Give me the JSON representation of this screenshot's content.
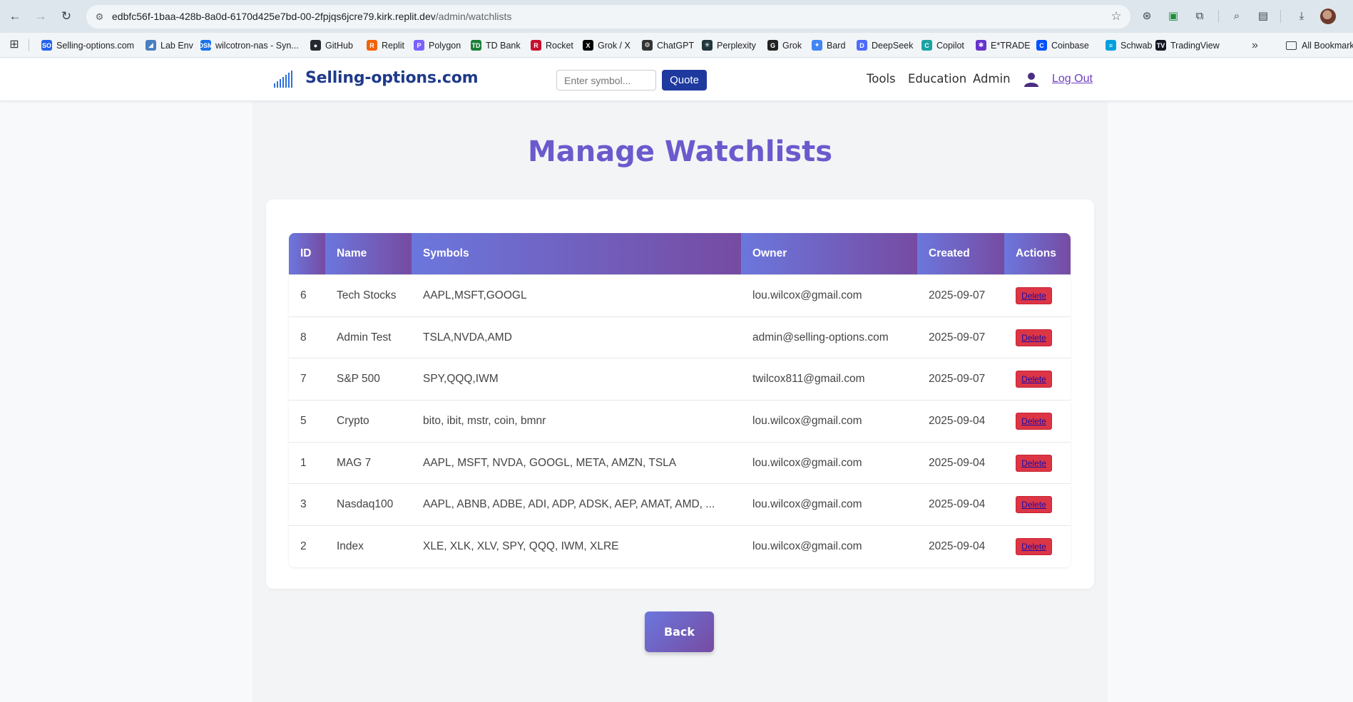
{
  "browser": {
    "url_main": "edbfc56f-1baa-428b-8a0d-6170d425e7bd-00-2fpjqs6jcre79.kirk.replit.dev",
    "url_path": "/admin/watchlists",
    "bookmarks": [
      {
        "label": "Selling-options.com",
        "color": "#2563eb",
        "glyph": "SO"
      },
      {
        "label": "Lab Env",
        "color": "#4a7fc1",
        "glyph": "◢"
      },
      {
        "label": "wilcotron-nas - Syn...",
        "color": "#1a73e8",
        "glyph": "DSM"
      },
      {
        "label": "GitHub",
        "color": "#24292f",
        "glyph": "●"
      },
      {
        "label": "Replit",
        "color": "#f26207",
        "glyph": "R"
      },
      {
        "label": "Polygon",
        "color": "#7b61ff",
        "glyph": "P"
      },
      {
        "label": "TD Bank",
        "color": "#1a7f37",
        "glyph": "TD"
      },
      {
        "label": "Rocket",
        "color": "#c8102e",
        "glyph": "R"
      },
      {
        "label": "Grok / X",
        "color": "#000000",
        "glyph": "X"
      },
      {
        "label": "ChatGPT",
        "color": "#333333",
        "glyph": "⚙"
      },
      {
        "label": "Perplexity",
        "color": "#20373b",
        "glyph": "✳"
      },
      {
        "label": "Grok",
        "color": "#222222",
        "glyph": "G"
      },
      {
        "label": "Bard",
        "color": "#4285f4",
        "glyph": "✦"
      },
      {
        "label": "DeepSeek",
        "color": "#4d6bfe",
        "glyph": "D"
      },
      {
        "label": "Copilot",
        "color": "#19a3a3",
        "glyph": "C"
      },
      {
        "label": "E*TRADE",
        "color": "#6633cc",
        "glyph": "✱"
      },
      {
        "label": "Coinbase",
        "color": "#0052ff",
        "glyph": "C"
      },
      {
        "label": "Schwab",
        "color": "#00a0df",
        "glyph": "≡"
      },
      {
        "label": "TradingView",
        "color": "#131722",
        "glyph": "TV"
      }
    ],
    "all_bookmarks": "All Bookmarks",
    "more": "»"
  },
  "header": {
    "brand": "Selling-options.com",
    "symbol_placeholder": "Enter symbol...",
    "quote_label": "Quote",
    "nav": {
      "tools": "Tools",
      "education": "Education",
      "admin": "Admin"
    },
    "logout": "Log Out",
    "brand_color": "#1e3a8a"
  },
  "main": {
    "title": "Manage Watchlists",
    "table": {
      "headers": {
        "id": "ID",
        "name": "Name",
        "symbols": "Symbols",
        "owner": "Owner",
        "created": "Created",
        "actions": "Actions"
      },
      "rows": [
        {
          "id": "6",
          "name": "Tech Stocks",
          "symbols": "AAPL,MSFT,GOOGL",
          "owner": "lou.wilcox@gmail.com",
          "created": "2025-09-07",
          "action": "Delete"
        },
        {
          "id": "8",
          "name": "Admin Test",
          "symbols": "TSLA,NVDA,AMD",
          "owner": "admin@selling-options.com",
          "created": "2025-09-07",
          "action": "Delete"
        },
        {
          "id": "7",
          "name": "S&P 500",
          "symbols": "SPY,QQQ,IWM",
          "owner": "twilcox811@gmail.com",
          "created": "2025-09-07",
          "action": "Delete"
        },
        {
          "id": "5",
          "name": "Crypto",
          "symbols": "bito, ibit, mstr, coin, bmnr",
          "owner": "lou.wilcox@gmail.com",
          "created": "2025-09-04",
          "action": "Delete"
        },
        {
          "id": "1",
          "name": "MAG 7",
          "symbols": "AAPL, MSFT, NVDA, GOOGL, META, AMZN, TSLA",
          "owner": "lou.wilcox@gmail.com",
          "created": "2025-09-04",
          "action": "Delete"
        },
        {
          "id": "3",
          "name": "Nasdaq100",
          "symbols": "AAPL, ABNB, ADBE, ADI, ADP, ADSK, AEP, AMAT, AMD, ...",
          "owner": "lou.wilcox@gmail.com",
          "created": "2025-09-04",
          "action": "Delete"
        },
        {
          "id": "2",
          "name": "Index",
          "symbols": "XLE, XLK, XLV, SPY, QQQ, IWM, XLRE",
          "owner": "lou.wilcox@gmail.com",
          "created": "2025-09-04",
          "action": "Delete"
        }
      ]
    },
    "back_label": "Back"
  },
  "colors": {
    "accent_title": "#6a5acd",
    "header_gradient_start": "#6b77dd",
    "header_gradient_end": "#764ba2",
    "delete_red": "#dc3545",
    "quote_blue": "#1e3a9f"
  }
}
